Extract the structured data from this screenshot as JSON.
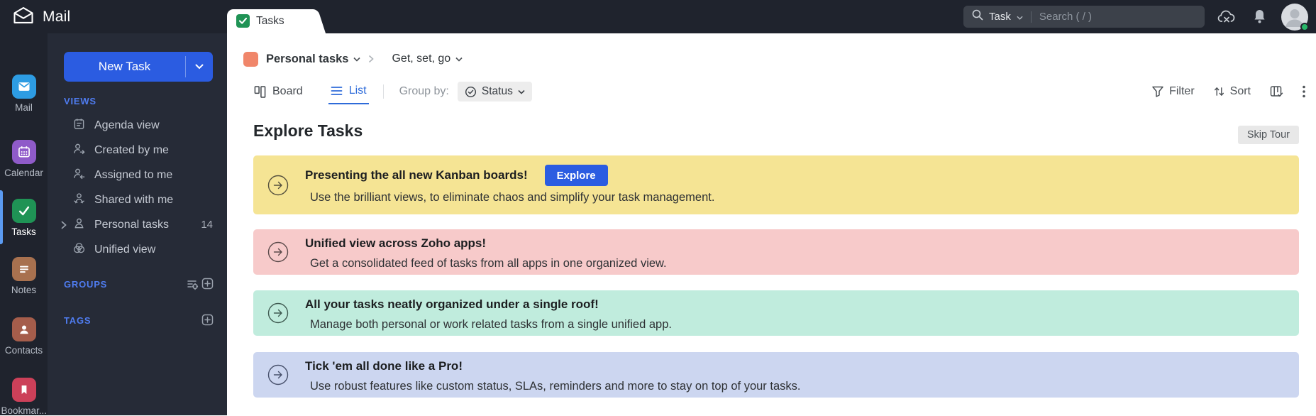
{
  "app": {
    "logo_text": "Mail"
  },
  "topbar": {
    "tab_label": "Tasks",
    "search": {
      "category": "Task",
      "placeholder": "Search ( / )"
    }
  },
  "rail": {
    "items": [
      {
        "label": "Mail",
        "color": "#2d9ce3"
      },
      {
        "label": "Calendar",
        "color": "#8f5bc9"
      },
      {
        "label": "Tasks",
        "color": "#1f9355",
        "active": true
      },
      {
        "label": "Notes",
        "color": "#a8714f"
      },
      {
        "label": "Contacts",
        "color": "#a55d4b"
      },
      {
        "label": "Bookmar...",
        "color": "#cc4059"
      }
    ]
  },
  "sidebar": {
    "new_task_label": "New Task",
    "views": {
      "heading": "VIEWS",
      "items": [
        {
          "label": "Agenda view"
        },
        {
          "label": "Created by me"
        },
        {
          "label": "Assigned to me"
        },
        {
          "label": "Shared with me"
        },
        {
          "label": "Personal tasks",
          "count": "14"
        },
        {
          "label": "Unified view"
        }
      ]
    },
    "groups_heading": "GROUPS",
    "tags_heading": "TAGS"
  },
  "main": {
    "breadcrumb": {
      "project": "Personal tasks",
      "section": "Get, set, go",
      "project_color": "#f0866a"
    },
    "toolbar": {
      "board_label": "Board",
      "list_label": "List",
      "group_by_label": "Group by:",
      "group_by_value": "Status",
      "filter_label": "Filter",
      "sort_label": "Sort"
    },
    "tour": {
      "title": "Explore Tasks",
      "skip_label": "Skip Tour"
    },
    "banners": [
      {
        "title": "Presenting the all new Kanban boards!",
        "subtitle": "Use the brilliant views, to eliminate chaos and simplify your task management.",
        "button_label": "Explore",
        "bg": "#f5e494"
      },
      {
        "title": "Unified view across Zoho apps!",
        "subtitle": "Get a consolidated feed of tasks from all apps in one organized view.",
        "bg": "#f7caca"
      },
      {
        "title": "All your tasks neatly organized under a single roof!",
        "subtitle": "Manage both personal or work related tasks from a single unified app.",
        "bg": "#c0ecdd"
      },
      {
        "title": "Tick 'em all done like a Pro!",
        "subtitle": "Use robust features like custom status, SLAs, reminders and more to stay on top of your tasks.",
        "bg": "#ccd6f0"
      }
    ]
  },
  "colors": {
    "topbar_bg": "#1f232d",
    "panel_bg": "#262b37",
    "accent_blue": "#2b5ce1",
    "heading_blue": "#4f7cf0",
    "active_list_blue": "#2e6bd9",
    "online_green": "#27b769"
  }
}
